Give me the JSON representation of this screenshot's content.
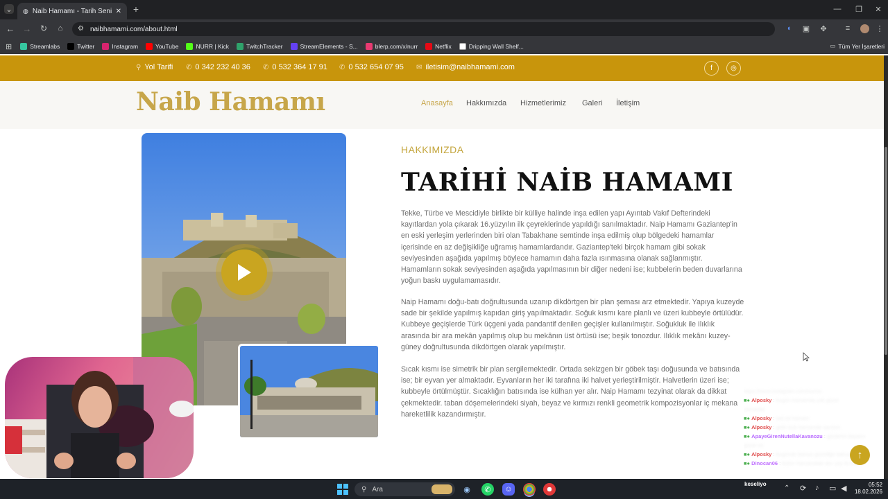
{
  "browser": {
    "tab_title": "Naib Hamamı - Tarih Seni Çağırıyor",
    "url": "naibhamami.com/about.html",
    "bookmarks": [
      {
        "label": "Streamlabs",
        "color": "#36c6a0"
      },
      {
        "label": "Twitter",
        "color": "#000000"
      },
      {
        "label": "Instagram",
        "color": "#d6246e"
      },
      {
        "label": "YouTube",
        "color": "#ff0000"
      },
      {
        "label": "NURR | Kick",
        "color": "#53fc18"
      },
      {
        "label": "TwitchTracker",
        "color": "#2fa36b"
      },
      {
        "label": "StreamElements - S...",
        "color": "#6441f4"
      },
      {
        "label": "blerp.com/x/nurr",
        "color": "#e83a71"
      },
      {
        "label": "Netflix",
        "color": "#e50914"
      },
      {
        "label": "Dripping Wall Shelf...",
        "color": "#ffffff"
      }
    ],
    "all_bookmarks": "Tüm Yer İşaretleri"
  },
  "site": {
    "topbar": {
      "directions": "Yol Tarifi",
      "phone1": "0 342 232 40 36",
      "phone2": "0 532 364 17 91",
      "phone3": "0 532 654 07 95",
      "email": "iletisim@naibhamami.com"
    },
    "logo": "Naib Hamamı",
    "nav": [
      "Anasayfa",
      "Hakkımızda",
      "Hizmetlerimiz",
      "Galeri",
      "İletişim"
    ],
    "about": {
      "eyebrow": "HAKKIMIZDA",
      "title": "TARİHİ NAİB HAMAMI",
      "p1": "Tekke, Türbe ve Mescidiyle birlikte bir külliye halinde inşa edilen yapı Ayıntab Vakıf Defterindeki kayıtlardan yola çıkarak 16.yüzyılın ilk çeyreklerinde yapıldığı sanılmaktadır. Naip Hamamı Gaziantep'in en eski yerleşim yerlerinden biri olan Tabakhane semtinde inşa edilmiş olup bölgedeki hamamlar içerisinde en az değişikliğe uğramış hamamlardandır. Gaziantep'teki birçok hamam gibi sokak seviyesinden aşağıda yapılmış böylece hamamın daha fazla ısınmasına olanak sağlanmıştır. Hamamların sokak seviyesinden aşağıda yapılmasının bir diğer nedeni ise; kubbelerin beden duvarlarına yoğun baskı uygulamamasıdır.",
      "p2": "Naip Hamamı doğu-batı doğrultusunda uzanıp dikdörtgen bir plan şeması arz etmektedir. Yapıya kuzeyde sade bir şekilde yapılmış kapıdan giriş yapılmaktadır. Soğuk kısmı kare planlı ve üzeri kubbeyle örtülüdür. Kubbeye geçişlerde Türk üçgeni yada pandantif denilen geçişler kullanılmıştır. Soğukluk ile Ilıklık arasında bir ara mekân yapılmış olup bu mekânın üst örtüsü ise; beşik tonozdur. Ilıklık mekânı kuzey-güney doğrultusunda dikdörtgen olarak yapılmıştır.",
      "p3": "Sıcak kısmı ise simetrik bir plan sergilemektedir. Ortada sekizgen bir göbek taşı doğusunda ve batısında ise; bir eyvan yer almaktadır. Eyvanların her iki tarafına iki halvet yerleştirilmiştir. Halvetlerin üzeri ise; kubbeyle örtülmüştür. Sıcaklığın batısında ise külhan yer alır. Naip Hamamı tezyinat olarak da dikkat çekmektedir. taban döşemelerindeki siyah, beyaz ve kırmızı renkli geometrik kompozisyonlar iç mekana hareketlilik kazandırmıştır."
    }
  },
  "chat": [
    {
      "user": "",
      "msg": "https://www.instagram.com/nurrxx",
      "color": "#aaa"
    },
    {
      "user": "Alposky",
      "msg": "bugün hamamda çok güzel",
      "color": "#e05050"
    },
    {
      "user": "",
      "msg": "zamanlar",
      "color": "#aaa"
    },
    {
      "user": "Alposky",
      "msg": "tad ed hamam",
      "color": "#e05050"
    },
    {
      "user": "Alposky",
      "msg": "gelin kub hamamda sacılsın",
      "color": "#e05050"
    },
    {
      "user": "ApayeGirenNutellaKavanozu",
      "msg": "günlerim dayanır",
      "color": "#b86bff"
    },
    {
      "user": "",
      "msg": "güzel mi",
      "color": "#aaa"
    },
    {
      "user": "Alposky",
      "msg": "bugünde bakıyo güzelliğe bakıyor",
      "color": "#e05050"
    },
    {
      "user": "Dinocan06",
      "msg": "bütün hamamdaki dev şey bi kuzey",
      "color": "#c070ff"
    }
  ],
  "taskbar": {
    "search": "Ara",
    "tray_label": "keseliyo",
    "time": "05:52",
    "date": "18.02.2026"
  },
  "colors": {
    "accent": "#c8950c",
    "gold": "#c7a64a"
  }
}
